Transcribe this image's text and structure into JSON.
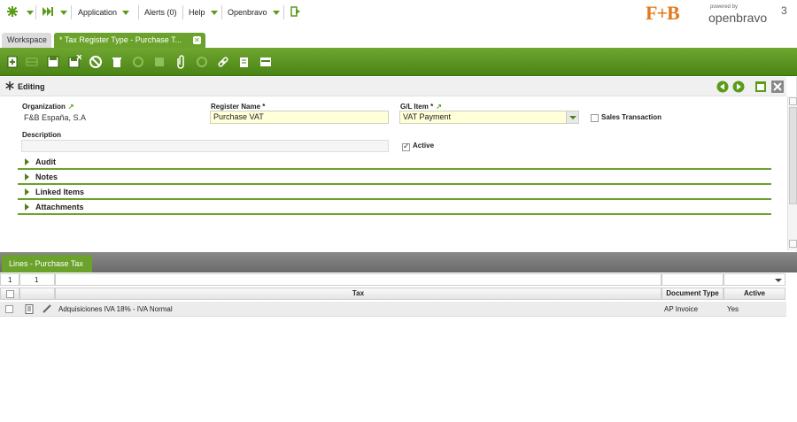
{
  "nav": {
    "application": "Application",
    "alerts": "Alerts (0)",
    "help": "Help",
    "openbravo": "Openbravo"
  },
  "brand": {
    "fb_logo": "F+B",
    "powered": "powered by",
    "openbravo": "openbravo",
    "version": "3"
  },
  "tabs": {
    "workspace": "Workspace",
    "active": "* Tax Register Type - Purchase T..."
  },
  "form": {
    "status": "Editing",
    "organization_label": "Organization",
    "organization_value": "F&B España, S.A",
    "register_name_label": "Register Name *",
    "register_name_value": "Purchase VAT",
    "gl_item_label": "G/L Item *",
    "gl_item_value": "VAT Payment",
    "sales_transaction_label": "Sales Transaction",
    "sales_transaction_checked": false,
    "description_label": "Description",
    "description_value": "",
    "active_label": "Active",
    "active_checked": true,
    "sections": [
      "Audit",
      "Notes",
      "Linked Items",
      "Attachments"
    ]
  },
  "lines": {
    "tab_label": "Lines - Purchase Tax",
    "count_left": "1",
    "count_right": "1",
    "columns": [
      "Tax",
      "Document Type",
      "Active"
    ],
    "rows": [
      {
        "tax": "Adquisiciones IVA 18% - IVA Normal",
        "document_type": "AP Invoice",
        "active": "Yes"
      }
    ]
  },
  "colors": {
    "accent_green": "#6aa22b",
    "dark_green": "#4a8415",
    "required_field": "#ffffd8",
    "left_strip": "#e8902a"
  }
}
